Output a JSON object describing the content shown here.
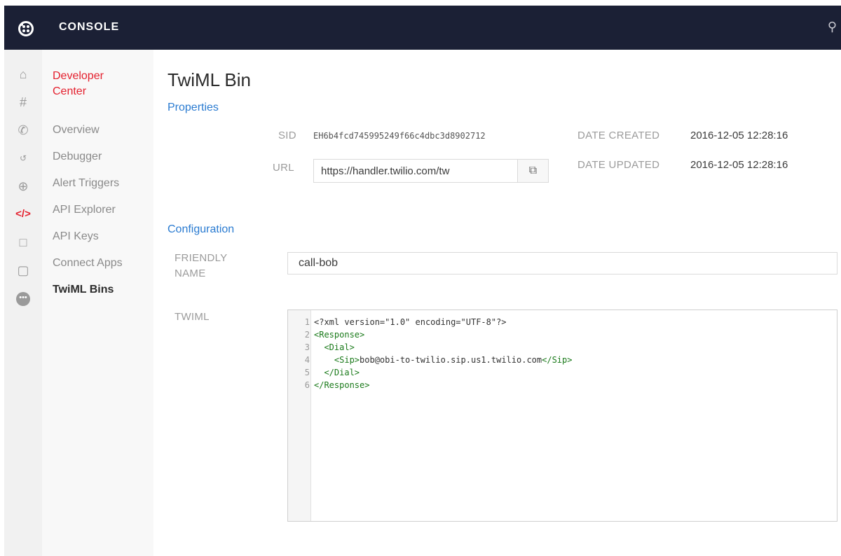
{
  "topbar": {
    "title": "CONSOLE"
  },
  "sidebar": {
    "title": "Developer Center",
    "items": [
      {
        "label": "Overview"
      },
      {
        "label": "Debugger"
      },
      {
        "label": "Alert Triggers"
      },
      {
        "label": "API Explorer"
      },
      {
        "label": "API Keys"
      },
      {
        "label": "Connect Apps"
      },
      {
        "label": "TwiML Bins",
        "active": true
      }
    ]
  },
  "rail_icons": [
    "home-icon",
    "hash-icon",
    "phone-icon",
    "sip-icon",
    "search-icon",
    "code-icon",
    "video-icon",
    "chat-icon",
    "more-icon"
  ],
  "page": {
    "title": "TwiML Bin"
  },
  "properties": {
    "heading": "Properties",
    "sid_label": "SID",
    "sid_value": "EH6b4fcd745995249f66c4dbc3d8902712",
    "url_label": "URL",
    "url_value": "https://handler.twilio.com/tw",
    "date_created_label": "DATE CREATED",
    "date_created_value": "2016-12-05 12:28:16",
    "date_updated_label": "DATE UPDATED",
    "date_updated_value": "2016-12-05 12:28:16"
  },
  "configuration": {
    "heading": "Configuration",
    "friendly_name_label_1": "FRIENDLY",
    "friendly_name_label_2": "NAME",
    "friendly_name_value": "call-bob",
    "twiml_label": "TWIML",
    "code_lines": [
      {
        "n": "1",
        "text": "<?xml version=\"1.0\" encoding=\"UTF-8\"?>"
      },
      {
        "n": "2",
        "text": "<Response>"
      },
      {
        "n": "3",
        "text": "  <Dial>"
      },
      {
        "n": "4",
        "text": "    <Sip>bob@obi-to-twilio.sip.us1.twilio.com</Sip>"
      },
      {
        "n": "5",
        "text": "  </Dial>"
      },
      {
        "n": "6",
        "text": "</Response>"
      }
    ]
  },
  "colors": {
    "topbar": "#1b2035",
    "brand_red": "#e4202e",
    "link_blue": "#2a7bd1",
    "xml_tag_green": "#1a7a1a"
  }
}
